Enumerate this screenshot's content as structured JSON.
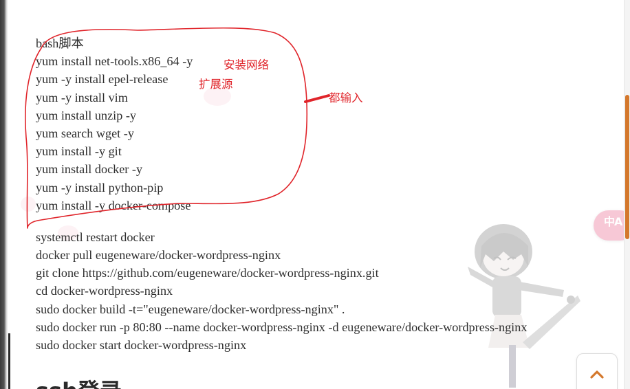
{
  "code_block": {
    "lines_group1": [
      "bash脚本",
      "yum install net-tools.x86_64 -y",
      "yum -y install epel-release",
      "yum -y install vim",
      "yum install unzip -y",
      "yum search wget -y",
      "yum install -y git",
      "yum install docker -y",
      "yum -y install python-pip",
      "yum install -y docker-compose"
    ],
    "lines_group2": [
      "systemctl restart docker",
      "docker pull eugeneware/docker-wordpress-nginx",
      "git clone https://github.com/eugeneware/docker-wordpress-nginx.git",
      "cd docker-wordpress-nginx",
      "sudo docker build -t=\"eugeneware/docker-wordpress-nginx\" .",
      "sudo docker run -p 80:80 --name docker-wordpress-nginx -d eugeneware/docker-wordpress-nginx",
      "sudo docker start docker-wordpress-nginx"
    ]
  },
  "annotations": {
    "install_network": "安装网络",
    "extension_source": "扩展源",
    "all_input": "都输入"
  },
  "section_heading": "ssh登录",
  "translate_button": {
    "glyph": "中A"
  },
  "icons": {
    "translate": "translate-icon",
    "back_to_top": "chevron-up-icon",
    "mascot": "anime-girl-mascot"
  },
  "colors": {
    "annotation_red": "#e0242a",
    "accent_orange": "#d4782c",
    "translate_pink": "#f7c8d6",
    "text": "#2e2e2e"
  }
}
